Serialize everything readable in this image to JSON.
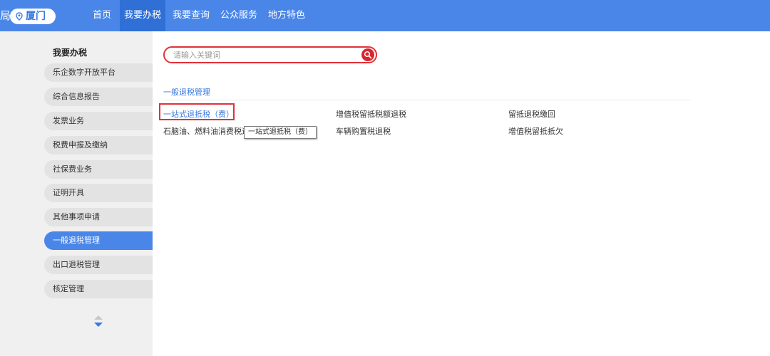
{
  "header": {
    "brand_fragment": "局",
    "city": "厦门",
    "nav": [
      "首页",
      "我要办税",
      "我要查询",
      "公众服务",
      "地方特色"
    ],
    "active_nav": "我要办税"
  },
  "sidebar": {
    "title": "我要办税",
    "items": [
      {
        "label": "乐企数字开放平台"
      },
      {
        "label": "综合信息报告"
      },
      {
        "label": "发票业务"
      },
      {
        "label": "税费申报及缴纳"
      },
      {
        "label": "社保费业务"
      },
      {
        "label": "证明开具"
      },
      {
        "label": "其他事项申请"
      },
      {
        "label": "一般退税管理"
      },
      {
        "label": "出口退税管理"
      },
      {
        "label": "核定管理"
      }
    ],
    "active_item": "一般退税管理"
  },
  "search": {
    "placeholder": "请输入关键词",
    "value": ""
  },
  "main": {
    "section_title": "一般退税管理",
    "links": [
      [
        "一站式退抵税（费）",
        "增值税留抵税额退税",
        "留抵退税缴回"
      ],
      [
        "石脑油、燃料油消费税退税",
        "车辆购置税退税",
        "增值税留抵抵欠"
      ]
    ],
    "tooltip": "一站式退抵税（费）"
  },
  "colors": {
    "topbar": "#4a86e8",
    "active_nav": "#2f6fd6",
    "sidebar_active": "#4a86e8",
    "highlight_red": "#e0323a",
    "link_blue": "#3a78e0"
  },
  "icons": {
    "location": "map-pin-icon",
    "search": "search-icon",
    "scroll": "up-down-arrows-icon"
  }
}
